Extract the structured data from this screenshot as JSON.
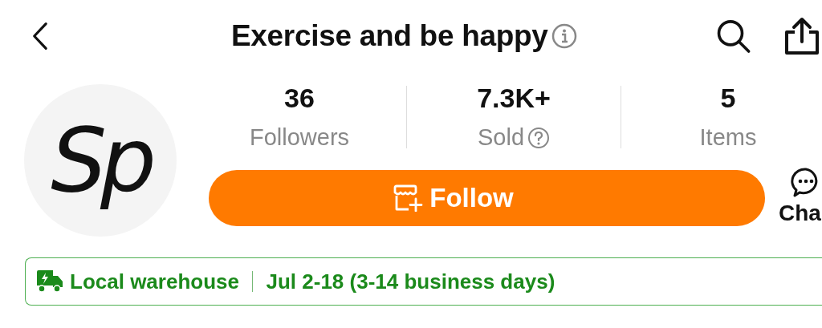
{
  "header": {
    "title": "Exercise and be happy"
  },
  "store": {
    "logo_text": "Sp"
  },
  "stats": [
    {
      "value": "36",
      "label": "Followers",
      "help": false
    },
    {
      "value": "7.3K+",
      "label": "Sold",
      "help": true
    },
    {
      "value": "5",
      "label": "Items",
      "help": false
    }
  ],
  "follow_button": {
    "label": "Follow"
  },
  "chat_button": {
    "label": "Cha"
  },
  "shipping": {
    "label": "Local warehouse",
    "estimate": "Jul 2-18 (3-14 business days)"
  }
}
